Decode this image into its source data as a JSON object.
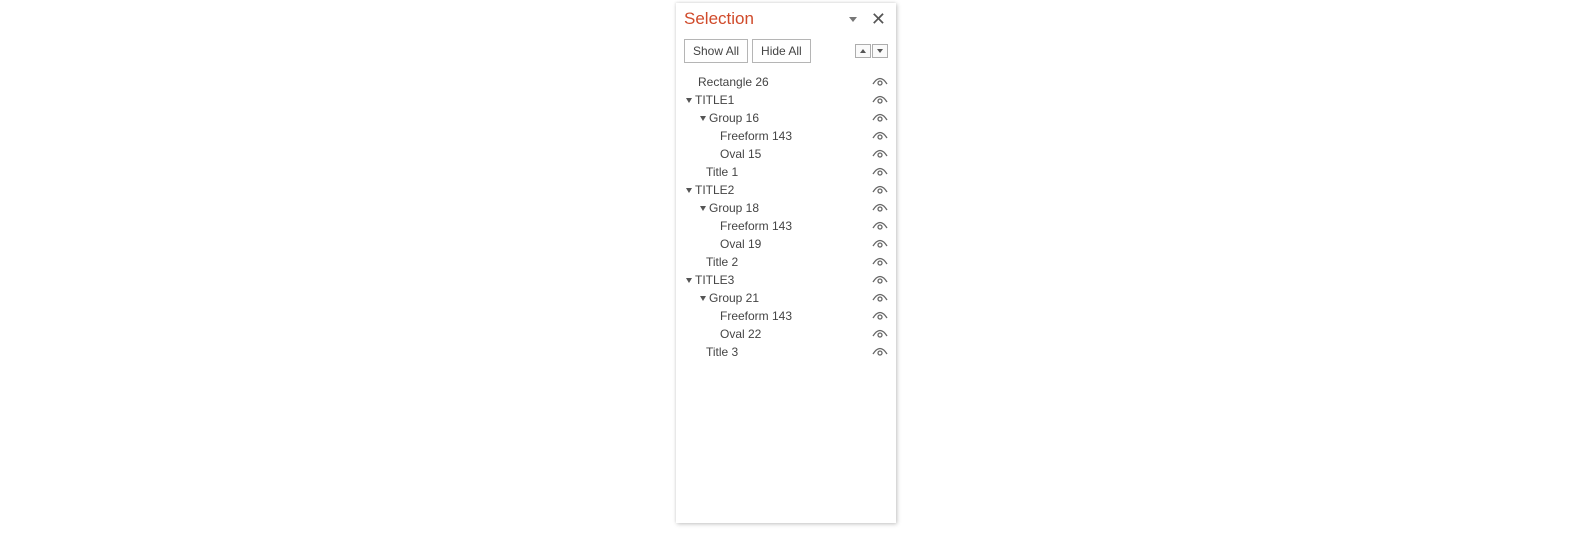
{
  "panel": {
    "title": "Selection",
    "show_all_label": "Show All",
    "hide_all_label": "Hide All"
  },
  "tree": {
    "items": [
      {
        "label": "Rectangle 26",
        "indent": 0,
        "hasCaret": false
      },
      {
        "label": "TITLE1",
        "indent": 1,
        "hasCaret": true
      },
      {
        "label": "Group 16",
        "indent": 2,
        "hasCaret": true
      },
      {
        "label": "Freeform 143",
        "indent": 3,
        "hasCaret": false
      },
      {
        "label": "Oval 15",
        "indent": 3,
        "hasCaret": false
      },
      {
        "label": "Title 1",
        "indent": "2b",
        "hasCaret": false
      },
      {
        "label": "TITLE2",
        "indent": 1,
        "hasCaret": true
      },
      {
        "label": "Group 18",
        "indent": 2,
        "hasCaret": true
      },
      {
        "label": "Freeform 143",
        "indent": 3,
        "hasCaret": false
      },
      {
        "label": "Oval 19",
        "indent": 3,
        "hasCaret": false
      },
      {
        "label": "Title 2",
        "indent": "2b",
        "hasCaret": false
      },
      {
        "label": "TITLE3",
        "indent": 1,
        "hasCaret": true
      },
      {
        "label": "Group 21",
        "indent": 2,
        "hasCaret": true
      },
      {
        "label": "Freeform 143",
        "indent": 3,
        "hasCaret": false
      },
      {
        "label": "Oval 22",
        "indent": 3,
        "hasCaret": false
      },
      {
        "label": "Title 3",
        "indent": "2b",
        "hasCaret": false
      }
    ]
  }
}
